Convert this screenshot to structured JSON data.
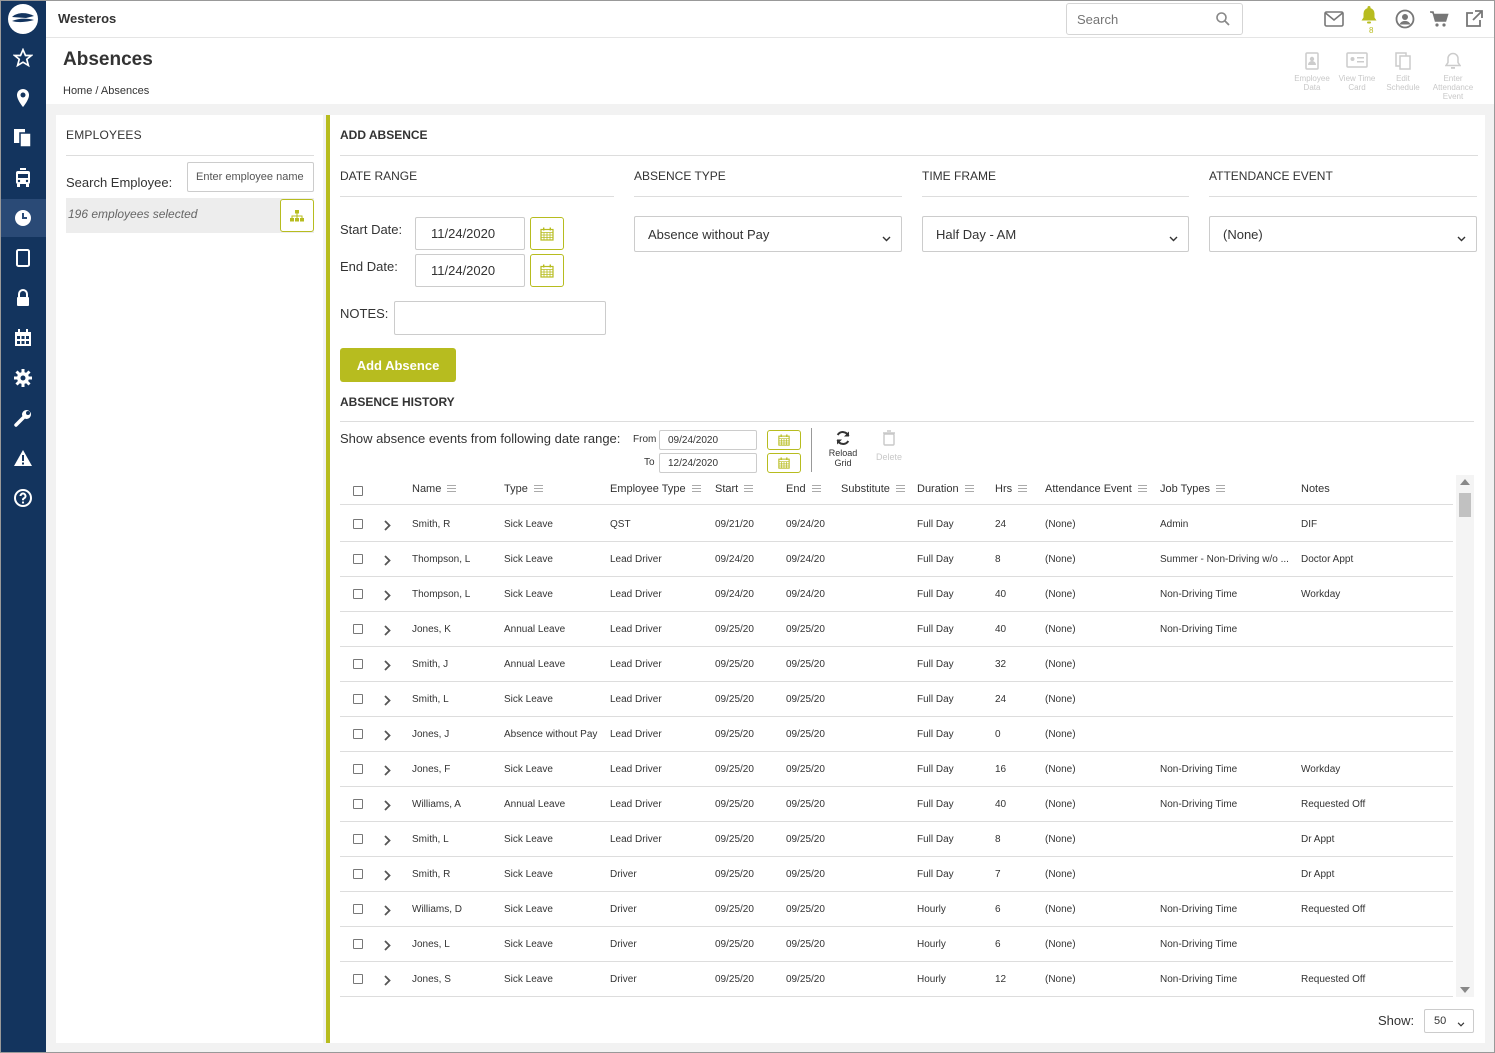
{
  "app": {
    "title": "Westeros"
  },
  "topbar": {
    "search_placeholder": "Search",
    "notification_count": "8",
    "icons": [
      "mail-icon",
      "bell-icon",
      "user-icon",
      "cart-icon",
      "external-link-icon"
    ]
  },
  "leftnav": {
    "icons": [
      "star-icon",
      "location-pin-icon",
      "documents-icon",
      "bus-icon",
      "clock-icon",
      "tablet-icon",
      "lock-icon",
      "calendar-icon",
      "gear-icon",
      "wrench-icon",
      "warning-icon",
      "help-icon"
    ],
    "active": "clock-icon"
  },
  "page": {
    "title": "Absences",
    "breadcrumb": {
      "home": "Home",
      "separator": "/",
      "current": "Absences"
    }
  },
  "actions": [
    {
      "label": "Employee Data",
      "icon": "employee-data-icon"
    },
    {
      "label": "View Time Card",
      "icon": "time-card-icon"
    },
    {
      "label": "Edit Schedule",
      "icon": "edit-schedule-icon"
    },
    {
      "label": "Enter Attendance Event",
      "icon": "bell-icon"
    }
  ],
  "employees": {
    "title": "EMPLOYEES",
    "search_label": "Search Employee:",
    "search_placeholder": "Enter employee name",
    "selected_text": "196 employees selected"
  },
  "add_absence": {
    "title": "ADD ABSENCE",
    "date_range": {
      "title": "DATE RANGE",
      "start_label": "Start Date:",
      "start_value": "11/24/2020",
      "end_label": "End Date:",
      "end_value": "11/24/2020"
    },
    "absence_type": {
      "title": "ABSENCE TYPE",
      "value": "Absence without Pay"
    },
    "time_frame": {
      "title": "TIME FRAME",
      "value": "Half Day - AM"
    },
    "attendance_event": {
      "title": "ATTENDANCE EVENT",
      "value": "(None)"
    },
    "notes_label": "NOTES:",
    "notes_value": "",
    "button_label": "Add Absence"
  },
  "history": {
    "title": "ABSENCE HISTORY",
    "range_label": "Show absence events from following date range:",
    "from_label": "From",
    "from_value": "09/24/2020",
    "to_label": "To",
    "to_value": "12/24/2020",
    "reload_label": "Reload Grid",
    "delete_label": "Delete",
    "columns": [
      "Name",
      "Type",
      "Employee Type",
      "Start",
      "End",
      "Substitute",
      "Duration",
      "Hrs",
      "Attendance Event",
      "Job Types",
      "Notes"
    ],
    "rows": [
      [
        "Smith, R",
        "Sick Leave",
        "QST",
        "09/21/20",
        "09/24/20",
        "",
        "Full Day",
        "24",
        "(None)",
        "Admin",
        "DIF"
      ],
      [
        "Thompson, L",
        "Sick Leave",
        "Lead Driver",
        "09/24/20",
        "09/24/20",
        "",
        "Full Day",
        "8",
        "(None)",
        "Summer - Non-Driving w/o ...",
        "Doctor Appt"
      ],
      [
        "Thompson, L",
        "Sick Leave",
        "Lead Driver",
        "09/24/20",
        "09/24/20",
        "",
        "Full Day",
        "40",
        "(None)",
        "Non-Driving Time",
        "Workday"
      ],
      [
        "Jones, K",
        "Annual Leave",
        "Lead Driver",
        "09/25/20",
        "09/25/20",
        "",
        "Full Day",
        "40",
        "(None)",
        "Non-Driving Time",
        ""
      ],
      [
        "Smith, J",
        "Annual Leave",
        "Lead Driver",
        "09/25/20",
        "09/25/20",
        "",
        "Full Day",
        "32",
        "(None)",
        "",
        ""
      ],
      [
        "Smith, L",
        "Sick Leave",
        "Lead Driver",
        "09/25/20",
        "09/25/20",
        "",
        "Full Day",
        "24",
        "(None)",
        "",
        ""
      ],
      [
        "Jones, J",
        "Absence without Pay",
        "Lead Driver",
        "09/25/20",
        "09/25/20",
        "",
        "Full Day",
        "0",
        "(None)",
        "",
        ""
      ],
      [
        "Jones, F",
        "Sick Leave",
        "Lead Driver",
        "09/25/20",
        "09/25/20",
        "",
        "Full Day",
        "16",
        "(None)",
        "Non-Driving Time",
        "Workday"
      ],
      [
        "Williams, A",
        "Annual Leave",
        "Lead Driver",
        "09/25/20",
        "09/25/20",
        "",
        "Full Day",
        "40",
        "(None)",
        "Non-Driving Time",
        "Requested Off"
      ],
      [
        "Smith, L",
        "Sick Leave",
        "Lead Driver",
        "09/25/20",
        "09/25/20",
        "",
        "Full Day",
        "8",
        "(None)",
        "",
        "Dr Appt"
      ],
      [
        "Smith, R",
        "Sick Leave",
        "Driver",
        "09/25/20",
        "09/25/20",
        "",
        "Full Day",
        "7",
        "(None)",
        "",
        "Dr Appt"
      ],
      [
        "Williams, D",
        "Sick Leave",
        "Driver",
        "09/25/20",
        "09/25/20",
        "",
        "Hourly",
        "6",
        "(None)",
        "Non-Driving Time",
        "Requested Off"
      ],
      [
        "Jones, L",
        "Sick Leave",
        "Driver",
        "09/25/20",
        "09/25/20",
        "",
        "Hourly",
        "6",
        "(None)",
        "Non-Driving Time",
        ""
      ],
      [
        "Jones, S",
        "Sick Leave",
        "Driver",
        "09/25/20",
        "09/25/20",
        "",
        "Hourly",
        "12",
        "(None)",
        "Non-Driving Time",
        "Requested Off"
      ]
    ],
    "show_label": "Show:",
    "page_size": "50"
  },
  "colors": {
    "accent": "#b7bc1f",
    "nav": "#13345e",
    "nav_active": "#2a4a76"
  }
}
